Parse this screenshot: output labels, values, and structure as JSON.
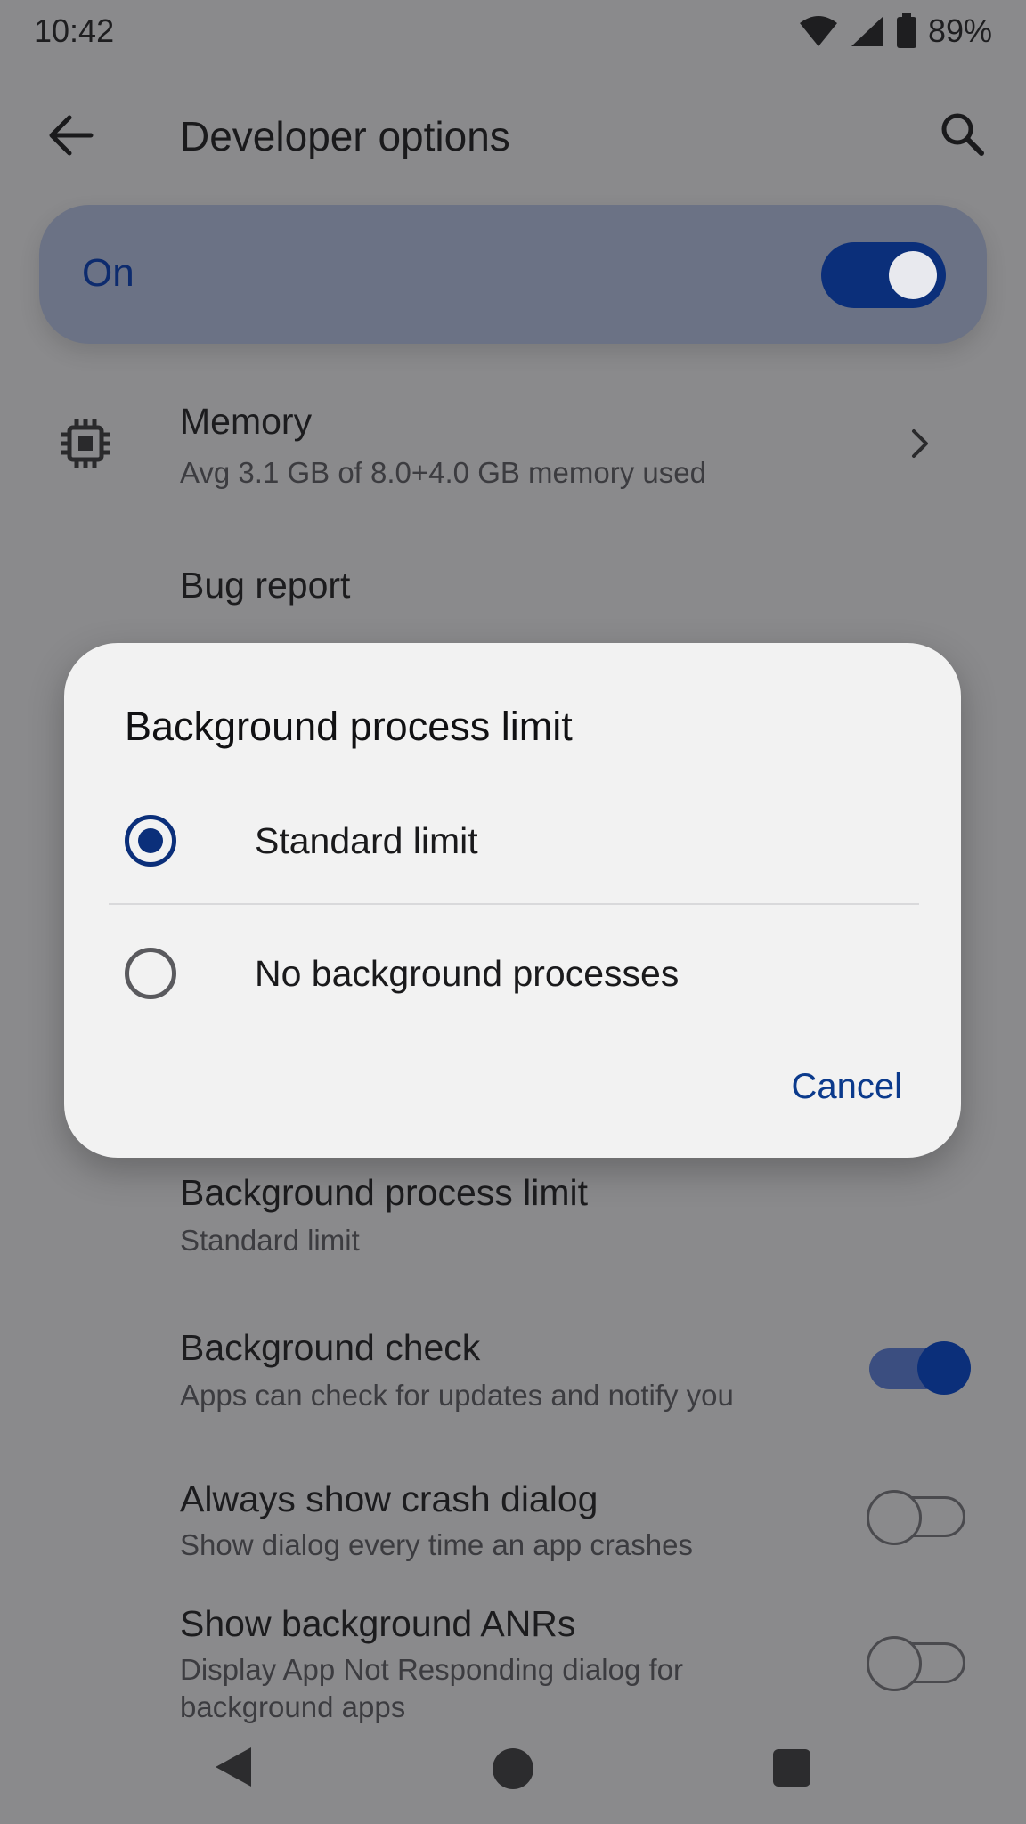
{
  "status_bar": {
    "time": "10:42",
    "battery_percent": "89%",
    "icons": [
      "wifi-icon",
      "signal-icon",
      "battery-icon"
    ]
  },
  "app_bar": {
    "title": "Developer options",
    "back_icon": "back-arrow-icon",
    "search_icon": "search-icon"
  },
  "master_toggle": {
    "label": "On",
    "state": "on"
  },
  "settings": {
    "memory": {
      "title": "Memory",
      "subtitle": "Avg 3.1 GB of 8.0+4.0 GB memory used",
      "icon": "memory-chip-icon"
    },
    "bug_report": {
      "title": "Bug report"
    },
    "background_process_limit": {
      "title": "Background process limit",
      "subtitle": "Standard limit"
    },
    "background_check": {
      "title": "Background check",
      "subtitle": "Apps can check for updates and notify you",
      "state": "on"
    },
    "always_show_crash_dialog": {
      "title": "Always show crash dialog",
      "subtitle": "Show dialog every time an app crashes",
      "state": "off"
    },
    "show_background_anrs": {
      "title": "Show background ANRs",
      "subtitle_line1": "Display App Not Responding dialog for",
      "subtitle_line2": "background apps",
      "state": "off"
    }
  },
  "dialog": {
    "title": "Background process limit",
    "options": [
      {
        "label": "Standard limit",
        "selected": true
      },
      {
        "label": "No background processes",
        "selected": false
      }
    ],
    "cancel_label": "Cancel"
  },
  "colors": {
    "accent": "#0b2f7a",
    "scrim_background": "#8a8a8c",
    "dialog_background": "#f2f2f2"
  }
}
